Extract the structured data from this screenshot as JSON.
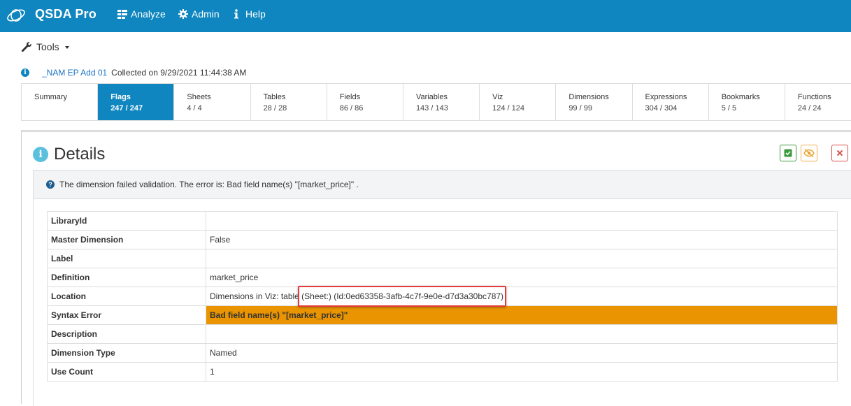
{
  "nav": {
    "brand": "QSDA Pro",
    "items": [
      {
        "label": "Analyze",
        "icon": "analyze-icon"
      },
      {
        "label": "Admin",
        "icon": "gear-icon"
      },
      {
        "label": "Help",
        "icon": "info-icon"
      }
    ]
  },
  "tools": {
    "label": "Tools",
    "icon": "wrench-icon"
  },
  "info": {
    "app_name": "_NAM EP Add 01",
    "collected_text": "Collected on 9/29/2021 11:44:38 AM"
  },
  "tabs": [
    {
      "label": "Summary",
      "count": ""
    },
    {
      "label": "Flags",
      "count": "247 / 247",
      "active": true
    },
    {
      "label": "Sheets",
      "count": "4 / 4"
    },
    {
      "label": "Tables",
      "count": "28 / 28"
    },
    {
      "label": "Fields",
      "count": "86 / 86"
    },
    {
      "label": "Variables",
      "count": "143 / 143"
    },
    {
      "label": "Viz",
      "count": "124 / 124"
    },
    {
      "label": "Dimensions",
      "count": "99 / 99"
    },
    {
      "label": "Expressions",
      "count": "304 / 304"
    },
    {
      "label": "Bookmarks",
      "count": "5 / 5"
    },
    {
      "label": "Functions",
      "count": "24 / 24"
    }
  ],
  "details": {
    "title": "Details",
    "alert": "The dimension failed validation. The error is: Bad field name(s) \"[market_price]\" .",
    "rows": [
      {
        "key": "LibraryId",
        "value": ""
      },
      {
        "key": "Master Dimension",
        "value": "False"
      },
      {
        "key": "Label",
        "value": ""
      },
      {
        "key": "Definition",
        "value": "market_price"
      },
      {
        "key": "Location",
        "value": "Dimensions in Viz: table  (Sheet:) (Id:0ed63358-3afb-4c7f-9e0e-d7d3a30bc787)"
      },
      {
        "key": "Syntax Error",
        "value": "Bad field name(s) \"[market_price]\""
      },
      {
        "key": "Description",
        "value": ""
      },
      {
        "key": "Dimension Type",
        "value": "Named"
      },
      {
        "key": "Use Count",
        "value": "1"
      }
    ]
  },
  "colors": {
    "nav_bg": "#0f86bf",
    "active_tab": "#0f86bf",
    "error_row": "#e99400",
    "highlight_box": "#e33a3a"
  }
}
